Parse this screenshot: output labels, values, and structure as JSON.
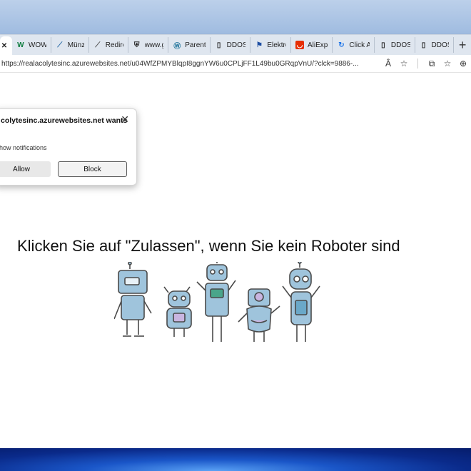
{
  "tabs": [
    {
      "label": "",
      "icon": "close-tab-icon",
      "active": true
    },
    {
      "label": "WOW",
      "icon": "w-logo-icon"
    },
    {
      "label": "Münze",
      "icon": "feather-icon"
    },
    {
      "label": "Redirec",
      "icon": "feather-icon"
    },
    {
      "label": "www.g",
      "icon": "shield-icon"
    },
    {
      "label": "Parent",
      "icon": "wordpress-icon"
    },
    {
      "label": "DDOS",
      "icon": "page-icon"
    },
    {
      "label": "Elektro",
      "icon": "flag-icon"
    },
    {
      "label": "AliExpr",
      "icon": "aliexpress-icon"
    },
    {
      "label": "Click A",
      "icon": "refresh-icon"
    },
    {
      "label": "DDOS",
      "icon": "page-icon"
    },
    {
      "label": "DDOS",
      "icon": "page-icon"
    }
  ],
  "toolbar": {
    "url": "https://realacolytesinc.azurewebsites.net/u04WfZPMYBlqpI8ggnYW6u0CPLjFF1L49bu0GRqpVnU/?clck=9886-...",
    "read_aloud_glyph": "Â",
    "favorite_glyph": "☆",
    "split_glyph": "⧉",
    "collections_glyph": "☆",
    "extensions_glyph": "⊕"
  },
  "popup": {
    "title": "colytesinc.azurewebsites.net wants",
    "message": "how notifications",
    "allow_label": "Allow",
    "block_label": "Block",
    "close_glyph": "✕"
  },
  "page": {
    "headline": "Klicken Sie auf \"Zulassen\", wenn Sie kein Roboter sind"
  },
  "colors": {
    "robot_fill": "#9fc4dc",
    "robot_stroke": "#4a4a4a",
    "robot_accent": "#c9b5e0"
  }
}
